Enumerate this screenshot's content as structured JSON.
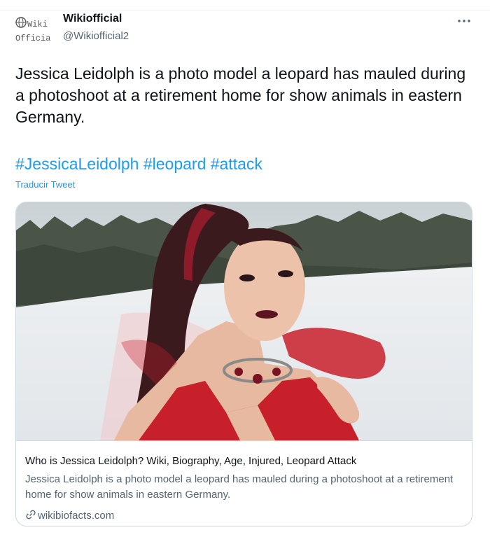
{
  "user": {
    "display_name": "Wikiofficial",
    "handle": "@Wikiofficial2",
    "avatar_text_top": "Wiki",
    "avatar_text_bottom": "Official"
  },
  "tweet": {
    "text": "Jessica Leidolph is a photo model a leopard has mauled during a photoshoot at a retirement home for show animals in eastern Germany.",
    "hashtags": [
      "#JessicaLeidolph",
      "#leopard",
      "#attack"
    ],
    "translate_label": "Traducir Tweet"
  },
  "card": {
    "title": "Who is Jessica Leidolph? Wiki, Biography, Age, Injured, Leopard Attack",
    "description": "Jessica Leidolph is a photo model a leopard has mauled during a photoshoot at a retirement home for show animals in eastern Germany.",
    "domain": "wikibiofacts.com"
  },
  "icons": {
    "more": "more-icon",
    "link": "link-icon",
    "globe": "globe-icon"
  },
  "colors": {
    "link": "#1d9bf0",
    "secondary_text": "#536471",
    "border": "#cfd9de",
    "dress_red": "#c8202a"
  }
}
